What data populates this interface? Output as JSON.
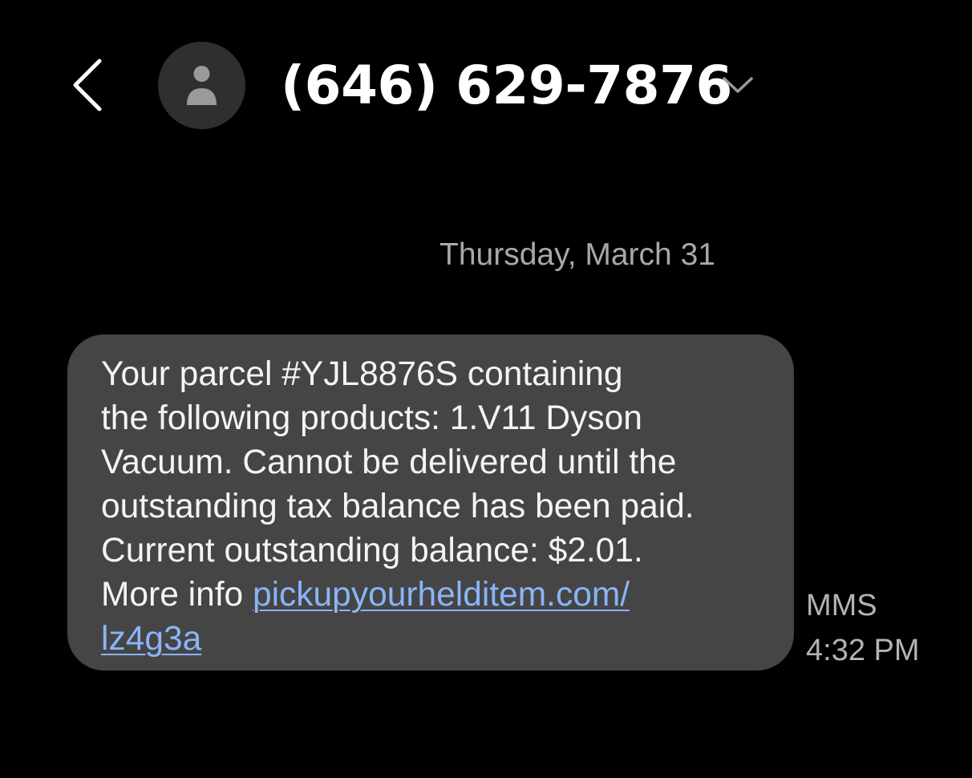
{
  "header": {
    "contact_name": "(646) 629-7876",
    "back_icon": "chevron-left-icon",
    "avatar_icon": "person-icon",
    "expand_icon": "chevron-down-icon"
  },
  "conversation": {
    "date_separator": "Thursday, March 31",
    "messages": [
      {
        "text_before_link": "Your parcel #YJL8876S containing\nthe following products: 1.V11 Dyson\nVacuum. Cannot be delivered until the\noutstanding tax balance has been paid.\nCurrent outstanding balance: $2.01.\nMore info ",
        "link_line1": "pickupyourhelditem.com/",
        "link_line2": "lz4g3a",
        "type_label": "MMS",
        "time": "4:32 PM"
      }
    ]
  },
  "colors": {
    "background": "#000000",
    "bubble": "#454545",
    "link": "#8ab4f8",
    "secondary_text": "#a8a8a8"
  }
}
